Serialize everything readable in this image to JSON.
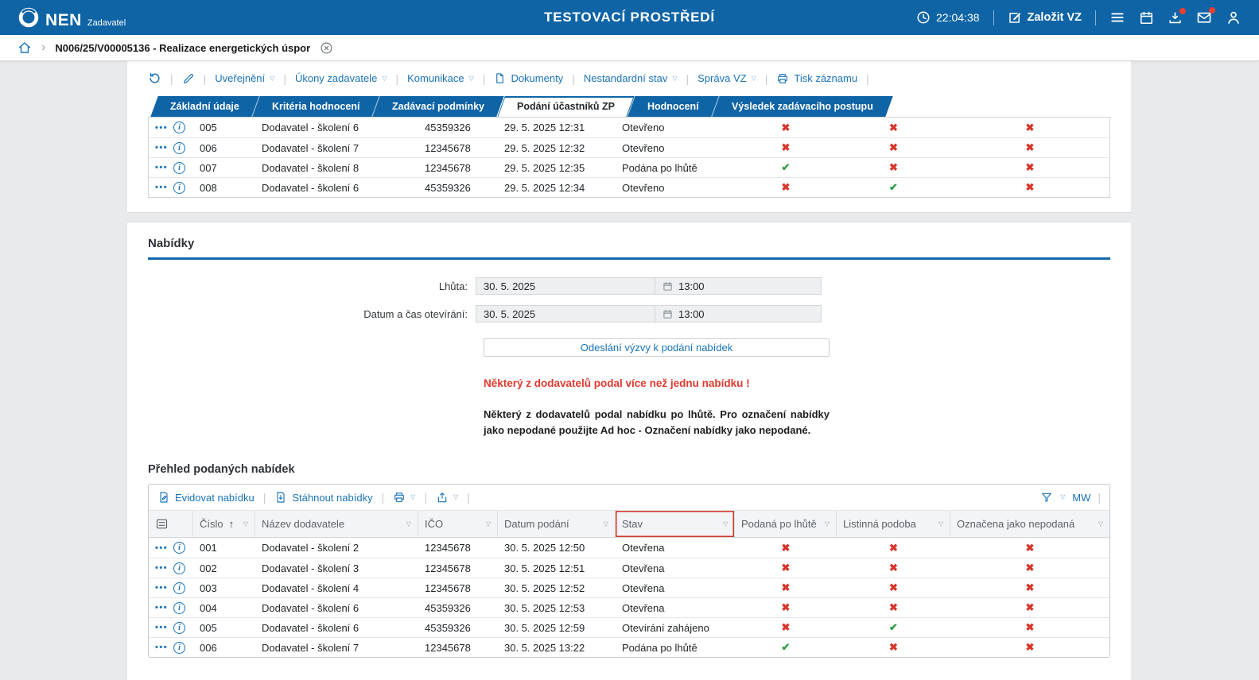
{
  "header": {
    "brand": "NEN",
    "brand_sub": "Zadavatel",
    "env_title": "TESTOVACÍ PROSTŘEDÍ",
    "clock": "22:04:38",
    "create_vz": "Založit VZ"
  },
  "breadcrumb": {
    "label": "N006/25/V00005136 - Realizace energetických úspor"
  },
  "record_toolbar": {
    "items": [
      {
        "label": "Uveřejnění"
      },
      {
        "label": "Úkony zadavatele"
      },
      {
        "label": "Komunikace"
      },
      {
        "label": "Dokumenty"
      },
      {
        "label": "Nestandardní stav"
      },
      {
        "label": "Správa VZ"
      },
      {
        "label": "Tisk záznamu"
      }
    ]
  },
  "tabs": [
    {
      "label": "Základní údaje",
      "active": false
    },
    {
      "label": "Kritéria hodnocení",
      "active": false
    },
    {
      "label": "Zadávací podmínky",
      "active": false
    },
    {
      "label": "Podání účastníků ZP",
      "active": true
    },
    {
      "label": "Hodnocení",
      "active": false
    },
    {
      "label": "Výsledek zadávacího postupu",
      "active": false
    }
  ],
  "participants_table": {
    "rows": [
      {
        "num": "005",
        "supplier": "Dodavatel - školení 6",
        "ico": "45359326",
        "date": "29. 5. 2025 12:31",
        "status": "Otevřeno",
        "marks": [
          false,
          false,
          false
        ]
      },
      {
        "num": "006",
        "supplier": "Dodavatel - školení 7",
        "ico": "12345678",
        "date": "29. 5. 2025 12:32",
        "status": "Otevřeno",
        "marks": [
          false,
          false,
          false
        ]
      },
      {
        "num": "007",
        "supplier": "Dodavatel - školení 8",
        "ico": "12345678",
        "date": "29. 5. 2025 12:35",
        "status": "Podána po lhůtě",
        "marks": [
          true,
          false,
          false
        ]
      },
      {
        "num": "008",
        "supplier": "Dodavatel - školení 6",
        "ico": "45359326",
        "date": "29. 5. 2025 12:34",
        "status": "Otevřeno",
        "marks": [
          false,
          true,
          false
        ]
      }
    ]
  },
  "offers_form": {
    "section_title": "Nabídky",
    "deadline_label": "Lhůta:",
    "deadline_date": "30. 5. 2025",
    "deadline_time": "13:00",
    "opening_label": "Datum a čas otevírání:",
    "opening_date": "30. 5. 2025",
    "opening_time": "13:00",
    "send_button": "Odeslání výzvy k podání nabídek",
    "warning": "Některý z dodavatelů podal více než jednu nabídku !",
    "note": "Některý z dodavatelů podal nabídku po lhůtě. Pro označení nabídky jako nepodané použijte Ad hoc - Označení nabídky jako nepodané."
  },
  "offers_table": {
    "title": "Přehled podaných nabídek",
    "toolbar": {
      "register": "Evidovat nabídku",
      "download": "Stáhnout nabídky",
      "right_label": "MW"
    },
    "columns": [
      "Číslo",
      "Název dodavatele",
      "IČO",
      "Datum podání",
      "Stav",
      "Podaná po lhůtě",
      "Listinná podoba",
      "Označena jako nepodaná"
    ],
    "rows": [
      {
        "num": "001",
        "supplier": "Dodavatel - školení 2",
        "ico": "12345678",
        "date": "30. 5. 2025 12:50",
        "status": "Otevřena",
        "marks": [
          false,
          false,
          false
        ]
      },
      {
        "num": "002",
        "supplier": "Dodavatel - školení 3",
        "ico": "12345678",
        "date": "30. 5. 2025 12:51",
        "status": "Otevřena",
        "marks": [
          false,
          false,
          false
        ]
      },
      {
        "num": "003",
        "supplier": "Dodavatel - školení 4",
        "ico": "12345678",
        "date": "30. 5. 2025 12:52",
        "status": "Otevřena",
        "marks": [
          false,
          false,
          false
        ]
      },
      {
        "num": "004",
        "supplier": "Dodavatel - školení 6",
        "ico": "45359326",
        "date": "30. 5. 2025 12:53",
        "status": "Otevřena",
        "marks": [
          false,
          false,
          false
        ]
      },
      {
        "num": "005",
        "supplier": "Dodavatel - školení 6",
        "ico": "45359326",
        "date": "30. 5. 2025 12:59",
        "status": "Otevírání zahájeno",
        "marks": [
          false,
          true,
          false
        ]
      },
      {
        "num": "006",
        "supplier": "Dodavatel - školení 7",
        "ico": "12345678",
        "date": "30. 5. 2025 13:22",
        "status": "Podána po lhůtě",
        "marks": [
          true,
          false,
          false
        ]
      }
    ]
  },
  "icons": {
    "dots": "•••",
    "info": "i",
    "dropdown": "▽",
    "sort_asc": "↑",
    "chevron": "›",
    "yes": "✔",
    "no": "✖"
  },
  "colors": {
    "header_blue": "#0f64a6",
    "link_blue": "#1973b9",
    "error_red": "#d8352a",
    "ok_green": "#2e9e44",
    "rule_blue": "#1467a8"
  }
}
